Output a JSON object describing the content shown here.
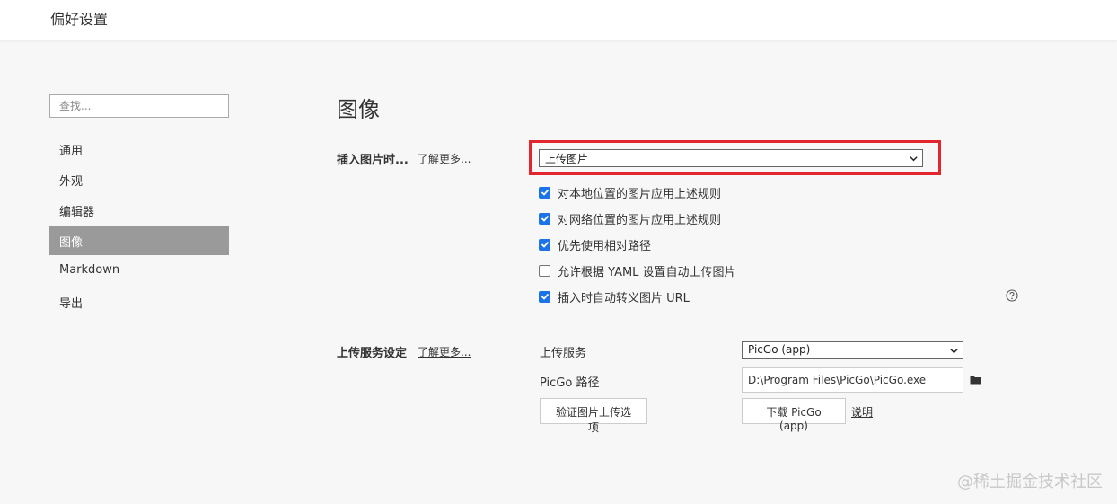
{
  "window": {
    "title": "偏好设置"
  },
  "search": {
    "placeholder": "查找..."
  },
  "sidebar": {
    "items": [
      {
        "label": "通用",
        "active": false
      },
      {
        "label": "外观",
        "active": false
      },
      {
        "label": "编辑器",
        "active": false
      },
      {
        "label": "图像",
        "active": true
      },
      {
        "label": "Markdown",
        "active": false
      },
      {
        "label": "导出",
        "active": false
      }
    ]
  },
  "main": {
    "section_title": "图像",
    "insert": {
      "label": "插入图片时...",
      "learn_more": "了解更多...",
      "select_value": "上传图片",
      "options": [
        {
          "label": "对本地位置的图片应用上述规则",
          "checked": true
        },
        {
          "label": "对网络位置的图片应用上述规则",
          "checked": true
        },
        {
          "label": "优先使用相对路径",
          "checked": true
        },
        {
          "label": "允许根据 YAML 设置自动上传图片",
          "checked": false
        },
        {
          "label": "插入时自动转义图片 URL",
          "checked": true
        }
      ]
    },
    "upload": {
      "label": "上传服务设定",
      "learn_more": "了解更多...",
      "service_label": "上传服务",
      "service_value": "PicGo (app)",
      "path_label": "PicGo 路径",
      "path_value": "D:\\Program Files\\PicGo\\PicGo.exe",
      "verify_button": "验证图片上传选项",
      "download_button": "下载 PicGo (app)",
      "explain_link": "说明"
    }
  },
  "watermark": "@稀土掘金技术社区",
  "colors": {
    "accent": "#1a73e8",
    "highlight": "#e3262d",
    "active_nav": "#9a9a9a"
  }
}
